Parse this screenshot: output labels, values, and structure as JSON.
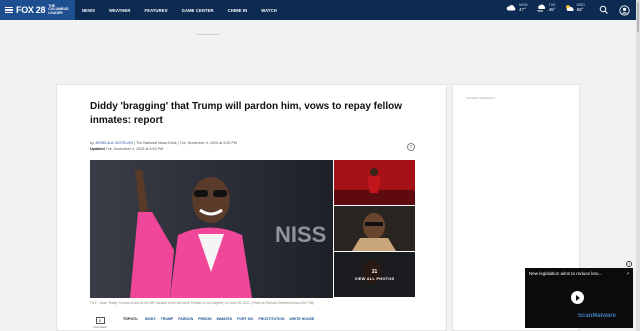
{
  "header": {
    "brand": "FOX 28",
    "brand_sub": "THE COLUMBUS LEADER",
    "nav": [
      "NEWS",
      "WEATHER",
      "FEATURES",
      "GAME CENTER",
      "CHIME IN",
      "WATCH"
    ],
    "weather": [
      {
        "period": "NOW",
        "temp": "47°",
        "icon": "cloud-icon"
      },
      {
        "period": "TUE",
        "temp": "45°",
        "icon": "cloud-wind-icon"
      },
      {
        "period": "WED",
        "temp": "58°",
        "icon": "partly-sunny-icon"
      }
    ],
    "colors": {
      "bar": "#0d2b52",
      "logo_bg": "#1d4f91"
    }
  },
  "article": {
    "headline": "Diddy 'bragging' that Trump will pardon him, vows to repay fellow inmates: report",
    "byline_prefix": "by",
    "author": "JESSICA A. BOTELHO",
    "byline_rest": "| The National News Desk | Tue, November 4, 2025 at 4:53 PM",
    "updated_label": "Updated",
    "updated_value": "Tue, November 4, 2025 at 4:53 PM",
    "caption": "FILE - Sean \"Diddy\" Combs arrives at the BET Awards at the Microsoft Theater in Los Angeles, on June 26, 2022. (Photo by Richard Shotwell/Invision/AP, File)",
    "gallery": {
      "count": "31",
      "label": "VIEW ALL PHOTOS"
    },
    "comments": {
      "count": "0",
      "label": "Comment"
    },
    "topics_label": "TOPICS:",
    "topics": [
      "DIDDY",
      "TRUMP",
      "PARDON",
      "PRISON",
      "INMATES",
      "FORT DIX",
      "PROSTITUTION",
      "WHITE HOUSE"
    ]
  },
  "rail": {
    "ad_label": "ADVERTISEMENT"
  },
  "video": {
    "title": "New legislation aims to reduce kno...",
    "close": "×",
    "watermark": "ScanMalware"
  }
}
